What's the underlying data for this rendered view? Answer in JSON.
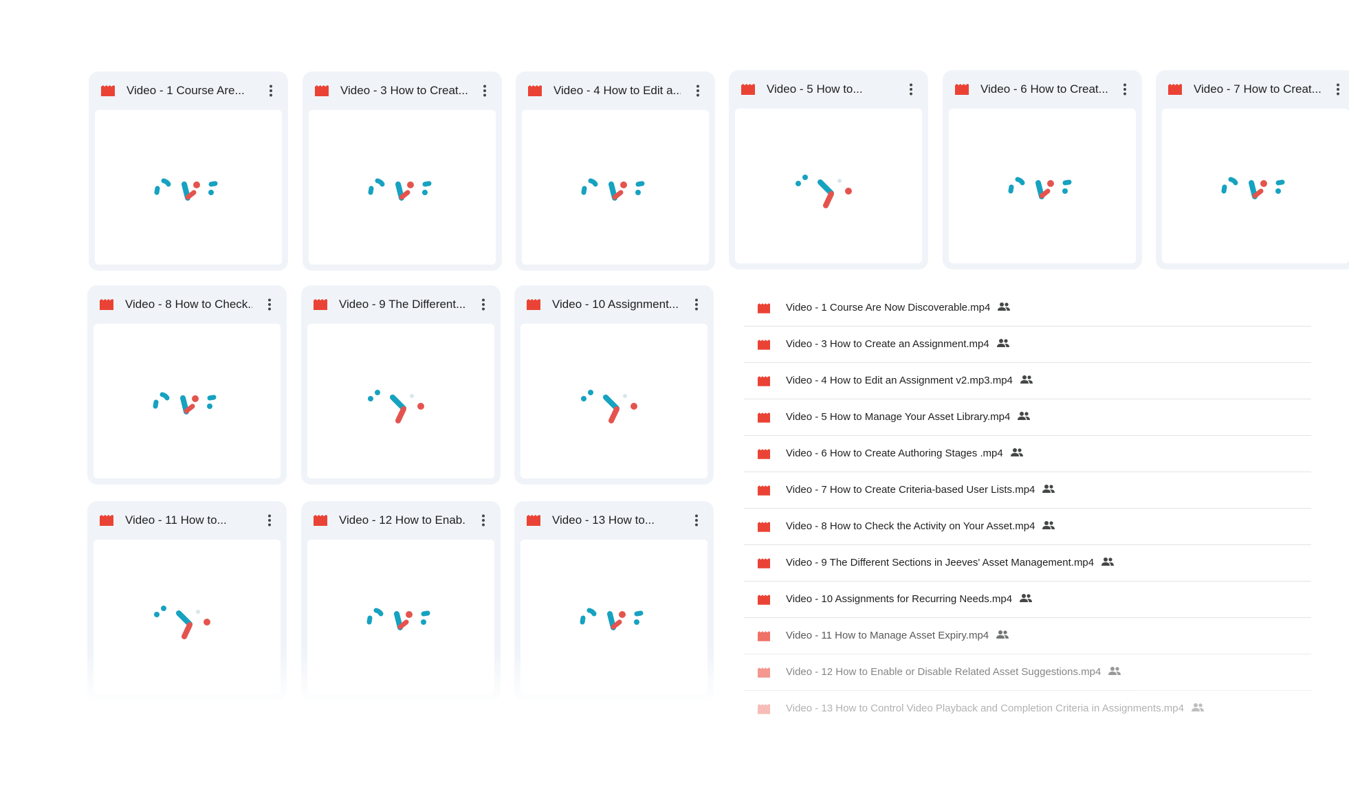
{
  "colors": {
    "accent_red": "#ea4335",
    "card_bg": "#f0f4f9",
    "teal": "#16a2c0",
    "coral": "#e4544e"
  },
  "icons": {
    "file": "video-file-icon",
    "menu": "more-vert-icon",
    "shared": "shared-people-icon"
  },
  "grid_cards": [
    {
      "title": "Video - 1 Course Are..."
    },
    {
      "title": "Video - 3 How to Creat..."
    },
    {
      "title": "Video - 4 How to Edit a..."
    },
    {
      "title": "Video - 5 How to..."
    },
    {
      "title": "Video - 6 How to Creat..."
    },
    {
      "title": "Video - 7 How to Creat..."
    },
    {
      "title": "Video - 8 How to Check..."
    },
    {
      "title": "Video - 9 The Different..."
    },
    {
      "title": "Video - 10 Assignment..."
    },
    {
      "title": "Video - 11 How to..."
    },
    {
      "title": "Video - 12 How to Enab..."
    },
    {
      "title": "Video - 13 How to..."
    }
  ],
  "file_list": [
    {
      "name": "Video - 1 Course Are Now Discoverable.mp4"
    },
    {
      "name": "Video - 3 How to Create an Assignment.mp4"
    },
    {
      "name": "Video - 4 How to Edit an Assignment v2.mp3.mp4"
    },
    {
      "name": "Video - 5 How to Manage Your Asset Library.mp4"
    },
    {
      "name": "Video - 6 How to Create Authoring Stages .mp4"
    },
    {
      "name": "Video - 7 How to Create Criteria-based User Lists.mp4"
    },
    {
      "name": "Video - 8 How to Check the Activity on Your Asset.mp4"
    },
    {
      "name": "Video - 9 The Different Sections in Jeeves' Asset Management.mp4"
    },
    {
      "name": "Video - 10 Assignments for Recurring Needs.mp4"
    },
    {
      "name": "Video - 11 How to Manage Asset Expiry.mp4"
    },
    {
      "name": "Video - 12 How to Enable or Disable Related Asset Suggestions.mp4"
    },
    {
      "name": "Video - 13 How to Control Video Playback and Completion Criteria in Assignments.mp4"
    }
  ]
}
